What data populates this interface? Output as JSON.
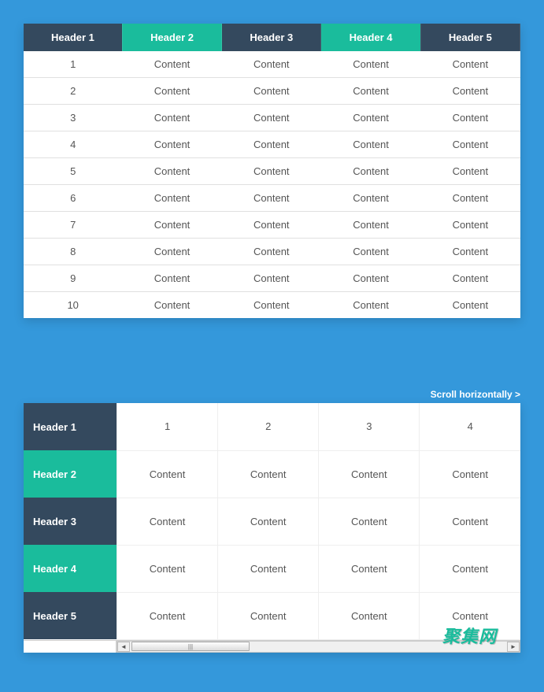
{
  "table1": {
    "headers": [
      {
        "label": "Header 1",
        "green": false
      },
      {
        "label": "Header 2",
        "green": true
      },
      {
        "label": "Header 3",
        "green": false
      },
      {
        "label": "Header 4",
        "green": true
      },
      {
        "label": "Header 5",
        "green": false
      }
    ],
    "rows": [
      {
        "id": "1",
        "cells": [
          "Content",
          "Content",
          "Content",
          "Content"
        ]
      },
      {
        "id": "2",
        "cells": [
          "Content",
          "Content",
          "Content",
          "Content"
        ]
      },
      {
        "id": "3",
        "cells": [
          "Content",
          "Content",
          "Content",
          "Content"
        ]
      },
      {
        "id": "4",
        "cells": [
          "Content",
          "Content",
          "Content",
          "Content"
        ]
      },
      {
        "id": "5",
        "cells": [
          "Content",
          "Content",
          "Content",
          "Content"
        ]
      },
      {
        "id": "6",
        "cells": [
          "Content",
          "Content",
          "Content",
          "Content"
        ]
      },
      {
        "id": "7",
        "cells": [
          "Content",
          "Content",
          "Content",
          "Content"
        ]
      },
      {
        "id": "8",
        "cells": [
          "Content",
          "Content",
          "Content",
          "Content"
        ]
      },
      {
        "id": "9",
        "cells": [
          "Content",
          "Content",
          "Content",
          "Content"
        ]
      },
      {
        "id": "10",
        "cells": [
          "Content",
          "Content",
          "Content",
          "Content"
        ]
      }
    ]
  },
  "scroll_hint": "Scroll horizontally >",
  "table2": {
    "rowHeaders": [
      {
        "label": "Header 1",
        "green": false
      },
      {
        "label": "Header 2",
        "green": true
      },
      {
        "label": "Header 3",
        "green": false
      },
      {
        "label": "Header 4",
        "green": true
      },
      {
        "label": "Header 5",
        "green": false
      }
    ],
    "rows": [
      [
        "1",
        "2",
        "3",
        "4"
      ],
      [
        "Content",
        "Content",
        "Content",
        "Content"
      ],
      [
        "Content",
        "Content",
        "Content",
        "Content"
      ],
      [
        "Content",
        "Content",
        "Content",
        "Content"
      ],
      [
        "Content",
        "Content",
        "Content",
        "Content"
      ]
    ]
  },
  "scrollbar": {
    "left_arrow": "◄",
    "right_arrow": "►",
    "thumb": "|||"
  },
  "watermark": "聚集网"
}
